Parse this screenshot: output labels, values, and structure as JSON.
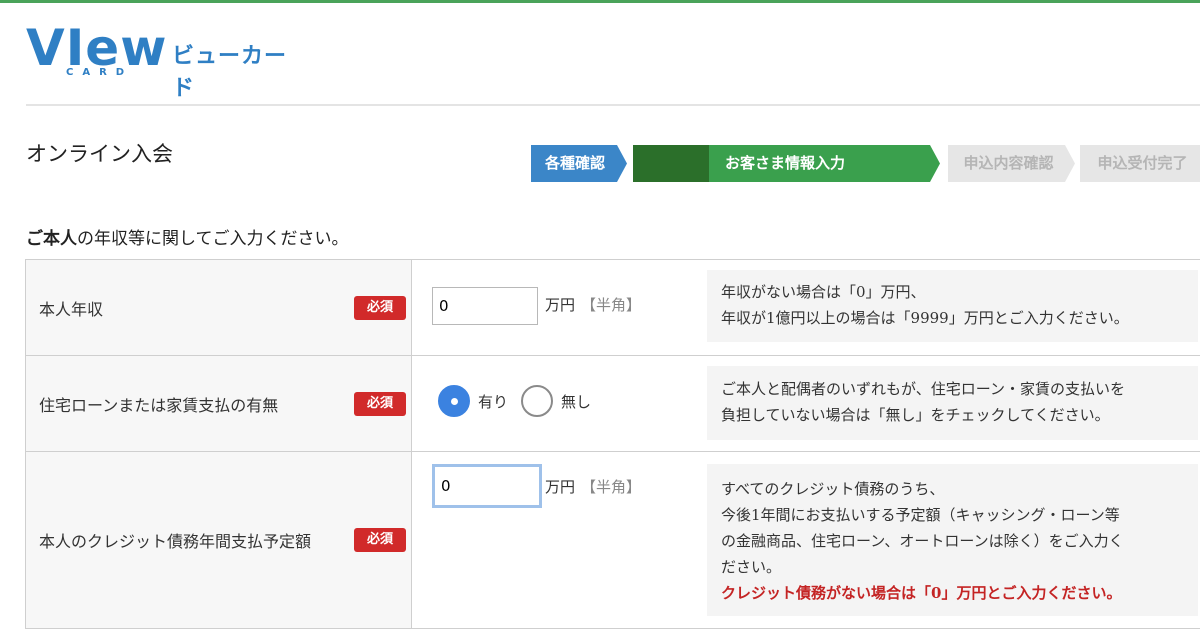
{
  "brand": {
    "logo_word": "VIew",
    "logo_sub": "CARD",
    "logo_jp": "ビューカード"
  },
  "page": {
    "title": "オンライン入会",
    "intro_bold": "ご本人",
    "intro_rest": "の年収等に関してご入力ください。"
  },
  "steps": [
    {
      "label": "各種確認",
      "state": "done"
    },
    {
      "label": "お客さま情報入力",
      "state": "current"
    },
    {
      "label": "申込内容確認",
      "state": "upcoming"
    },
    {
      "label": "申込受付完了",
      "state": "upcoming"
    }
  ],
  "form": {
    "required_badge": "必須",
    "unit_label": "万円",
    "half_width_note": "【半角】",
    "annual_income": {
      "label": "本人年収",
      "value": "0",
      "help": [
        "年収がない場合は「0」万円、",
        "年収が1億円以上の場合は「9999」万円とご入力ください。"
      ]
    },
    "housing_payment": {
      "label": "住宅ローンまたは家賃支払の有無",
      "options": [
        {
          "label": "有り",
          "selected": true
        },
        {
          "label": "無し",
          "selected": false
        }
      ],
      "help": [
        "ご本人と配偶者のいずれもが、住宅ローン・家賃の支払いを",
        "負担していない場合は「無し」をチェックしてください。"
      ]
    },
    "credit_debt": {
      "label": "本人のクレジット債務年間支払予定額",
      "value": "0",
      "help": [
        "すべてのクレジット債務のうち、",
        "今後1年間にお支払いする予定額（キャッシング・ローン等",
        "の金融商品、住宅ローン、オートローンは除く）をご入力く",
        "ださい。"
      ],
      "help_warning": "クレジット債務がない場合は「0」万円とご入力ください。"
    }
  },
  "colors": {
    "brand_blue": "#2f7fc4",
    "step_done": "#3b86c8",
    "step_current": "#3aa04d",
    "required_red": "#d12a2a",
    "warning_red": "#c42424"
  }
}
